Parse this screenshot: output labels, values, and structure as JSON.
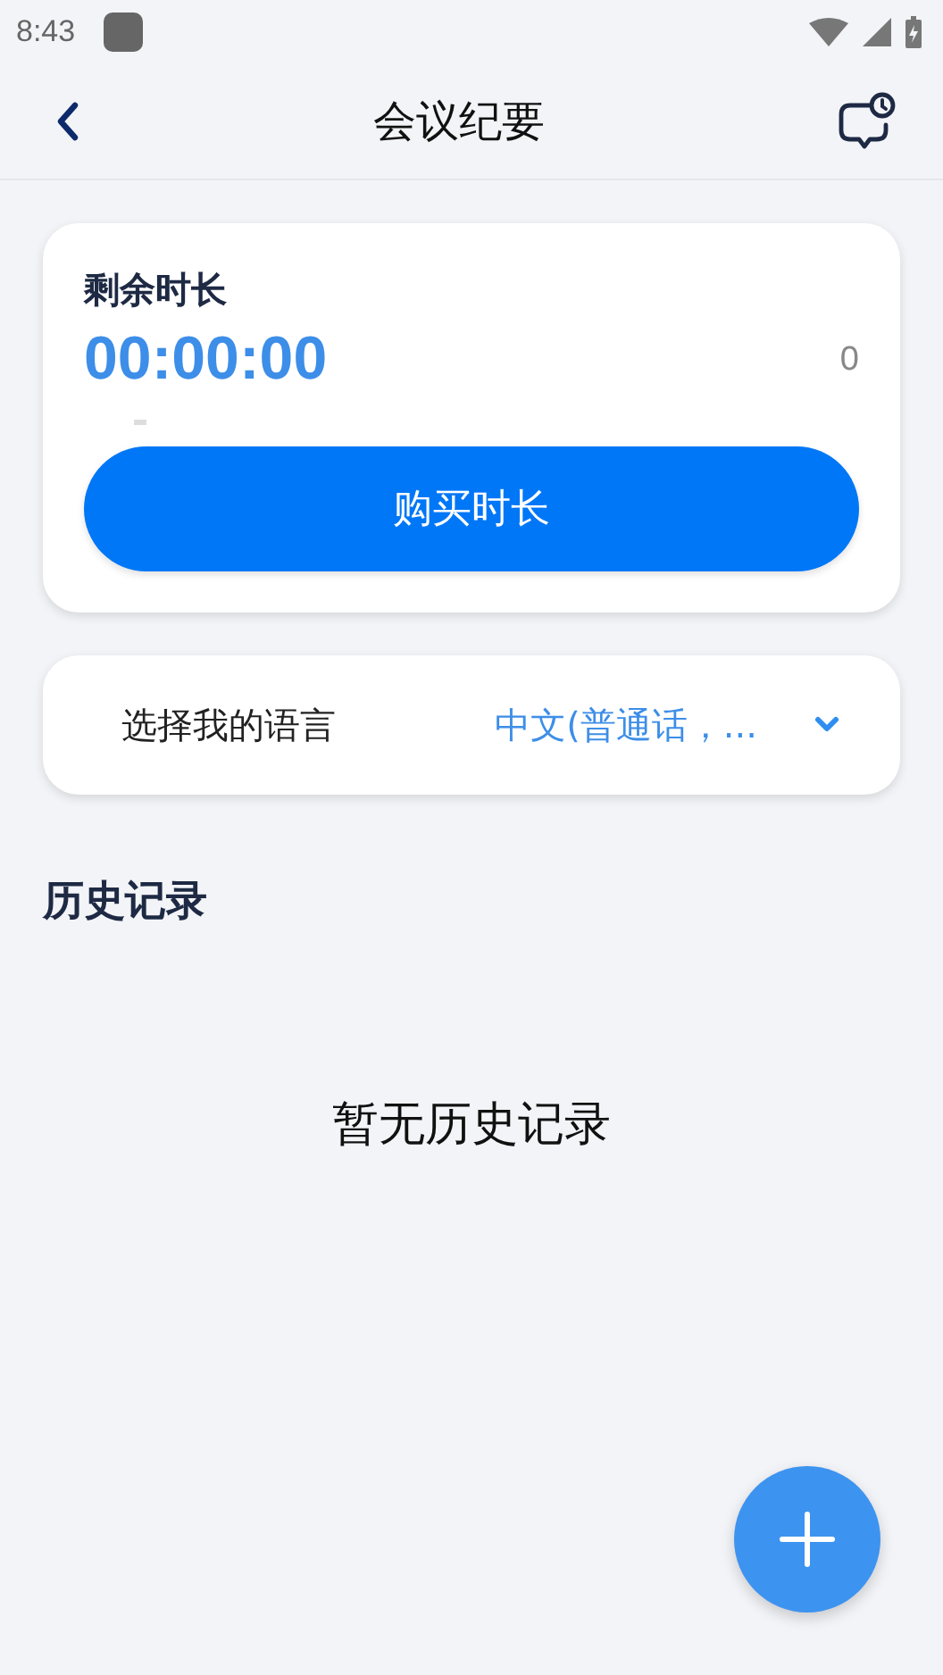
{
  "status_bar": {
    "time": "8:43"
  },
  "header": {
    "title": "会议纪要"
  },
  "balance_card": {
    "label": "剩余时长",
    "time": "00:00:00",
    "count": "0",
    "button": "购买时长"
  },
  "language": {
    "label": "选择我的语言",
    "value": "中文(普通话，..."
  },
  "history": {
    "title": "历史记录",
    "empty": "暂无历史记录"
  }
}
